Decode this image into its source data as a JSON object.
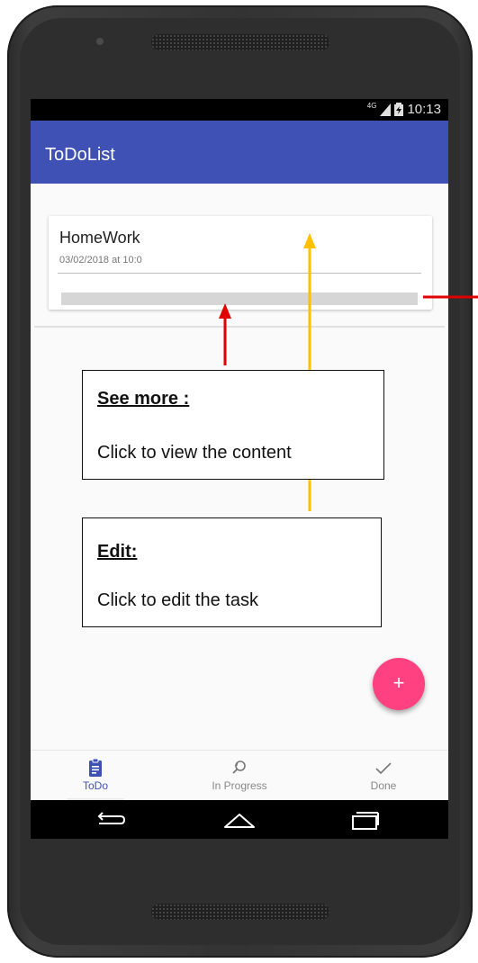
{
  "status_bar": {
    "network": "4G",
    "time": "10:13"
  },
  "app_bar": {
    "title": "ToDoList"
  },
  "card": {
    "title": "HomeWork",
    "date": "03/02/2018 at 10:0"
  },
  "fab": {
    "label": "+"
  },
  "bottom_nav": {
    "items": [
      {
        "label": "ToDo",
        "icon": "clipboard-icon",
        "active": true
      },
      {
        "label": "In Progress",
        "icon": "search-icon",
        "active": false
      },
      {
        "label": "Done",
        "icon": "checkmark-icon",
        "active": false
      }
    ]
  },
  "callouts": {
    "see_more": {
      "title": "See more :",
      "text": "Click to view the content"
    },
    "edit": {
      "title": "Edit:",
      "text": "Click to edit the task"
    }
  },
  "colors": {
    "primary": "#3f51b5",
    "accent": "#ff4081",
    "arrow_red": "#e00000",
    "arrow_yellow": "#ffc000"
  }
}
